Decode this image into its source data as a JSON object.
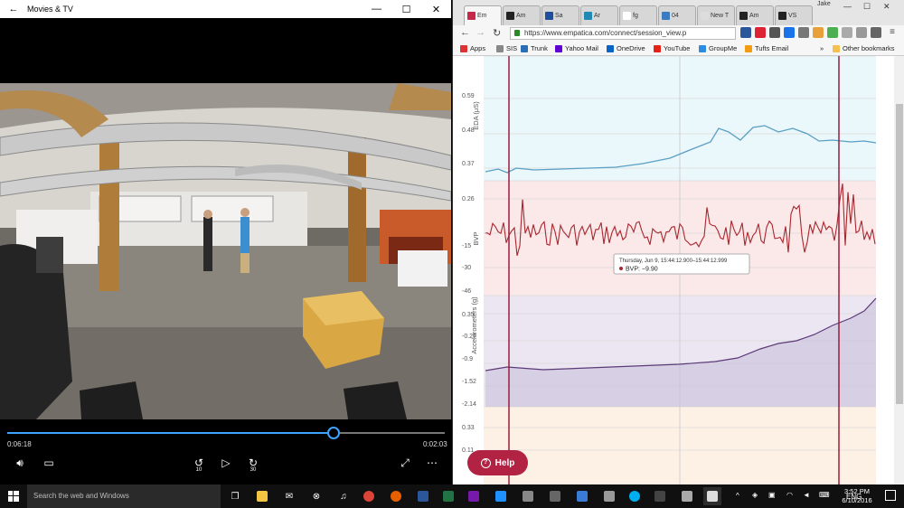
{
  "movies_app": {
    "title": "Movies & TV",
    "elapsed": "0:06:18",
    "remaining": "0:02:03",
    "progress": 0.745,
    "skip_back_seconds": "10",
    "skip_forward_seconds": "30"
  },
  "browser": {
    "tabs": [
      {
        "label": "Em",
        "color": "#c4294a",
        "active": true
      },
      {
        "label": "Am",
        "color": "#222222"
      },
      {
        "label": "Sa",
        "color": "#1f4e9b"
      },
      {
        "label": "Ar",
        "color": "#2089b3"
      },
      {
        "label": "fg",
        "color": "#ffffff"
      },
      {
        "label": "04",
        "color": "#3b7bbf"
      },
      {
        "label": "New T",
        "color": "#dddddd"
      },
      {
        "label": "Am",
        "color": "#222222"
      },
      {
        "label": "VS",
        "color": "#222222"
      }
    ],
    "user": "Jake",
    "url": "https://www.empatica.com/connect/session_view.p",
    "bookmarks": [
      {
        "label": "Apps",
        "color": "#d33"
      },
      {
        "label": "SIS",
        "color": "#888"
      },
      {
        "label": "Trunk",
        "color": "#2a6fb5"
      },
      {
        "label": "Yahoo Mail",
        "color": "#5f01d1"
      },
      {
        "label": "OneDrive",
        "color": "#0a64c8"
      },
      {
        "label": "YouTube",
        "color": "#e62117"
      },
      {
        "label": "GroupMe",
        "color": "#2e8ce0"
      },
      {
        "label": "Tufts Email",
        "color": "#f39c12"
      }
    ],
    "bookmarks_more": "»",
    "other_bookmarks": "Other bookmarks"
  },
  "session_view": {
    "eda": {
      "label": "EDA (μS)",
      "ticks": [
        "0.59",
        "0.48",
        "0.37"
      ]
    },
    "bvp": {
      "label": "BVP",
      "ticks": [
        "0.26",
        "-15",
        "-30",
        "-46"
      ]
    },
    "acc": {
      "label": "Accelerometers (g)",
      "ticks": [
        "0.35",
        "-0.27",
        "-0.9",
        "-1.52",
        "-2.14"
      ]
    },
    "extra": {
      "ticks": [
        "0.33",
        "0.11"
      ]
    },
    "tooltip": {
      "time": "Thursday, Jun 9, 15:44:12.900–15:44:12.999",
      "value": "BVP: −9.90"
    },
    "help_label": "Help",
    "colors": {
      "eda": "#5a9fc4",
      "bvp": "#a8262e",
      "acc": "#5b3a78",
      "marker": "#9b1d3c"
    }
  },
  "taskbar": {
    "search_placeholder": "Search the web and Windows",
    "language": "ENG",
    "time": "3:52 PM",
    "date": "6/10/2016"
  }
}
